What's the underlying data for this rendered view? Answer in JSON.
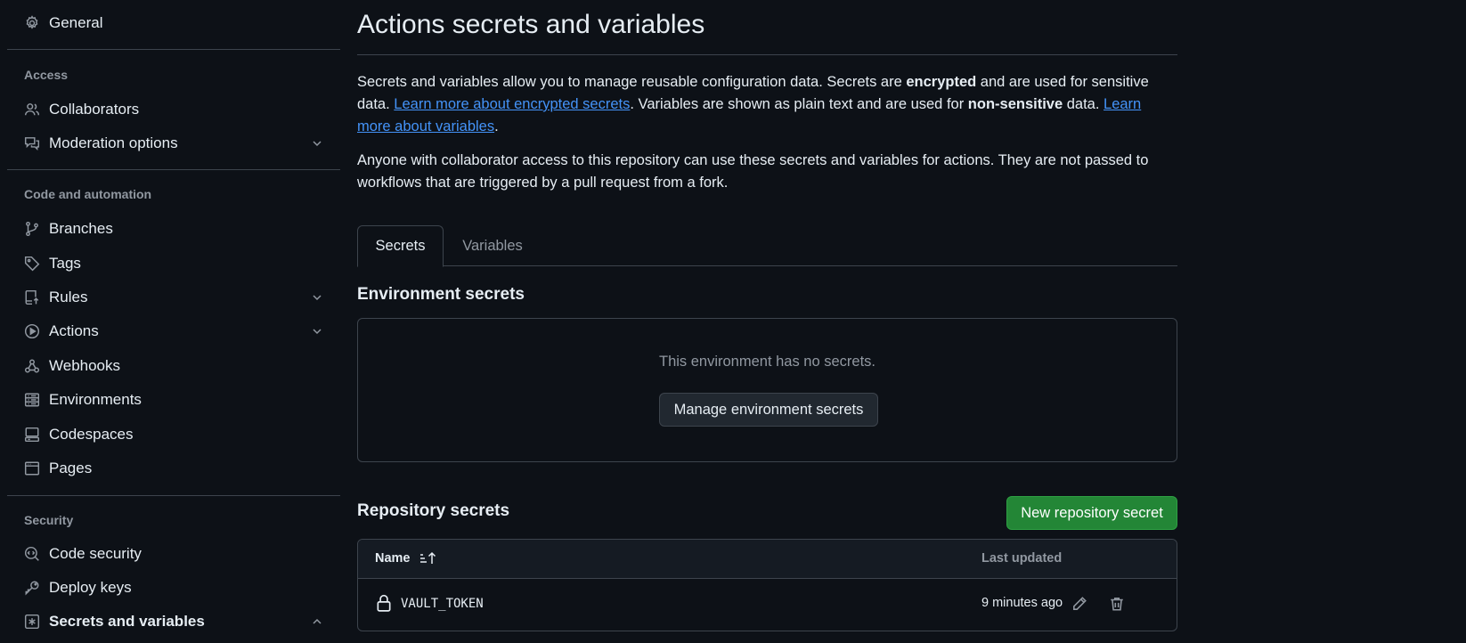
{
  "sidebar": {
    "items": [
      {
        "label": "General",
        "icon": "gear-icon"
      },
      {
        "label": "Collaborators",
        "icon": "people-icon"
      },
      {
        "label": "Moderation options",
        "icon": "comment-discussion-icon"
      },
      {
        "label": "Branches",
        "icon": "git-branch-icon"
      },
      {
        "label": "Tags",
        "icon": "tag-icon"
      },
      {
        "label": "Rules",
        "icon": "repo-push-icon"
      },
      {
        "label": "Actions",
        "icon": "play-icon"
      },
      {
        "label": "Webhooks",
        "icon": "webhook-icon"
      },
      {
        "label": "Environments",
        "icon": "server-icon"
      },
      {
        "label": "Codespaces",
        "icon": "codespaces-icon"
      },
      {
        "label": "Pages",
        "icon": "browser-icon"
      },
      {
        "label": "Code security",
        "icon": "codescan-icon"
      },
      {
        "label": "Deploy keys",
        "icon": "key-icon"
      },
      {
        "label": "Secrets and variables",
        "icon": "key-asterisk-icon"
      }
    ],
    "headings": {
      "access": "Access",
      "code_automation": "Code and automation",
      "security": "Security"
    }
  },
  "main": {
    "title": "Actions secrets and variables",
    "intro": {
      "t1": "Secrets and variables allow you to manage reusable configuration data. Secrets are ",
      "b1": "encrypted",
      "t2": " and are used for sensitive data. ",
      "link1": "Learn more about encrypted secrets",
      "t3": ". Variables are shown as plain text and are used for ",
      "b2": "non-sensitive",
      "t4": " data. ",
      "link2": "Learn more about variables",
      "t5": "."
    },
    "access_note": "Anyone with collaborator access to this repository can use these secrets and variables for actions. They are not passed to workflows that are triggered by a pull request from a fork.",
    "tabs": [
      {
        "label": "Secrets",
        "active": true
      },
      {
        "label": "Variables",
        "active": false
      }
    ],
    "environment_secrets": {
      "title": "Environment secrets",
      "empty_text": "This environment has no secrets.",
      "manage_button": "Manage environment secrets"
    },
    "repository_secrets": {
      "title": "Repository secrets",
      "new_button": "New repository secret",
      "columns": {
        "name": "Name",
        "last_updated": "Last updated"
      },
      "rows": [
        {
          "name": "VAULT_TOKEN",
          "last_updated": "9 minutes ago"
        }
      ]
    }
  },
  "colors": {
    "background": "#0d1117",
    "border": "#3d444d",
    "link": "#4493f8",
    "primary_button": "#238636",
    "muted_text": "#9198a1"
  }
}
